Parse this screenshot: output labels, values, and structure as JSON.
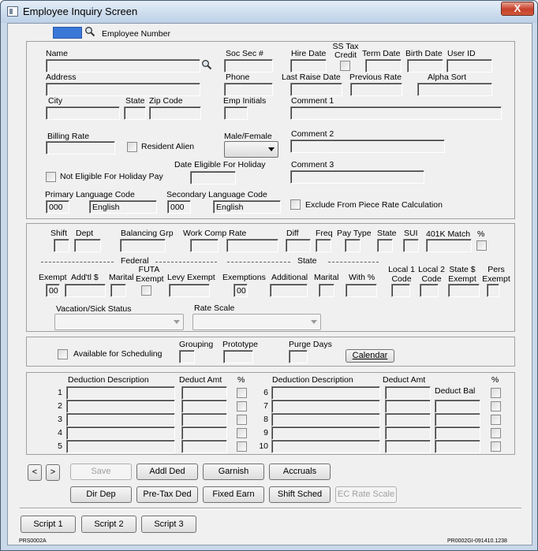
{
  "window": {
    "title": "Employee Inquiry Screen",
    "close_label": "X"
  },
  "top": {
    "employee_number_label": "Employee Number"
  },
  "personal": {
    "name": "Name",
    "soc_sec": "Soc Sec #",
    "hire_date": "Hire Date",
    "ss_tax": "SS Tax",
    "credit": "Credit",
    "term_date": "Term Date",
    "birth_date": "Birth Date",
    "user_id": "User ID",
    "address": "Address",
    "phone": "Phone",
    "last_raise_date": "Last Raise Date",
    "previous_rate": "Previous Rate",
    "alpha_sort": "Alpha Sort",
    "city": "City",
    "state": "State",
    "zip_code": "Zip Code",
    "emp_initials": "Emp Initials",
    "comment1": "Comment 1",
    "billing_rate": "Billing Rate",
    "resident_alien": "Resident Alien",
    "male_female": "Male/Female",
    "comment2": "Comment 2",
    "date_eligible_holiday": "Date Eligible For Holiday",
    "not_eligible_holiday": "Not Eligible For Holiday Pay",
    "comment3": "Comment 3",
    "primary_language_label": "Primary Language Code",
    "primary_language_code": "000",
    "primary_language_name": "English",
    "secondary_language_label": "Secondary Language Code",
    "secondary_language_code": "000",
    "secondary_language_name": "English",
    "exclude_piece_rate": "Exclude From Piece Rate Calculation"
  },
  "payroll": {
    "shift": "Shift",
    "dept": "Dept",
    "balancing_grp": "Balancing Grp",
    "work_comp_rate": "Work Comp Rate",
    "diff": "Diff",
    "freq": "Freq",
    "pay_type": "Pay Type",
    "state": "State",
    "sui": "SUI",
    "k401_match": "401K Match",
    "percent": "%",
    "federal": "Federal",
    "state_section": "State",
    "exempt": "Exempt",
    "addtl": "Add'tl  $",
    "marital": "Marital",
    "futa1": "FUTA",
    "futa2": "Exempt",
    "levy_exempt": "Levy Exempt",
    "exemptions": "Exemptions",
    "additional": "Additional",
    "marital2": "Marital",
    "with_pct": "With %",
    "local1_a": "Local 1",
    "local1_b": "Code",
    "local2_a": "Local 2",
    "local2_b": "Code",
    "state_exempt_a": "State $",
    "state_exempt_b": "Exempt",
    "pers_exempt_a": "Pers",
    "pers_exempt_b": "Exempt",
    "fed_exempt_value": "00",
    "state_exemptions_value": "00",
    "vacation_sick": "Vacation/Sick Status",
    "rate_scale": "Rate Scale"
  },
  "scheduling": {
    "available": "Available for Scheduling",
    "grouping": "Grouping",
    "prototype": "Prototype",
    "purge_days": "Purge Days",
    "calendar": "Calendar"
  },
  "deductions": {
    "desc_header": "Deduction Description",
    "amt_header": "Deduct Amt",
    "pct_header": "%",
    "bal_header": "Deduct Bal",
    "left_rows": [
      "1",
      "2",
      "3",
      "4",
      "5"
    ],
    "right_rows": [
      "6",
      "7",
      "8",
      "9",
      "10"
    ]
  },
  "buttons": {
    "prev": "<",
    "next": ">",
    "save": "Save",
    "addl_ded": "Addl Ded",
    "garnish": "Garnish",
    "accruals": "Accruals",
    "dir_dep": "Dir Dep",
    "pretax_ded": "Pre-Tax Ded",
    "fixed_earn": "Fixed Earn",
    "shift_sched": "Shift Sched",
    "ec_rate_scale": "EC Rate Scale",
    "script1": "Script 1",
    "script2": "Script 2",
    "script3": "Script 3"
  },
  "footer": {
    "left_code": "PRS0002A",
    "right_code": "PR0002GI-091410.1238"
  }
}
